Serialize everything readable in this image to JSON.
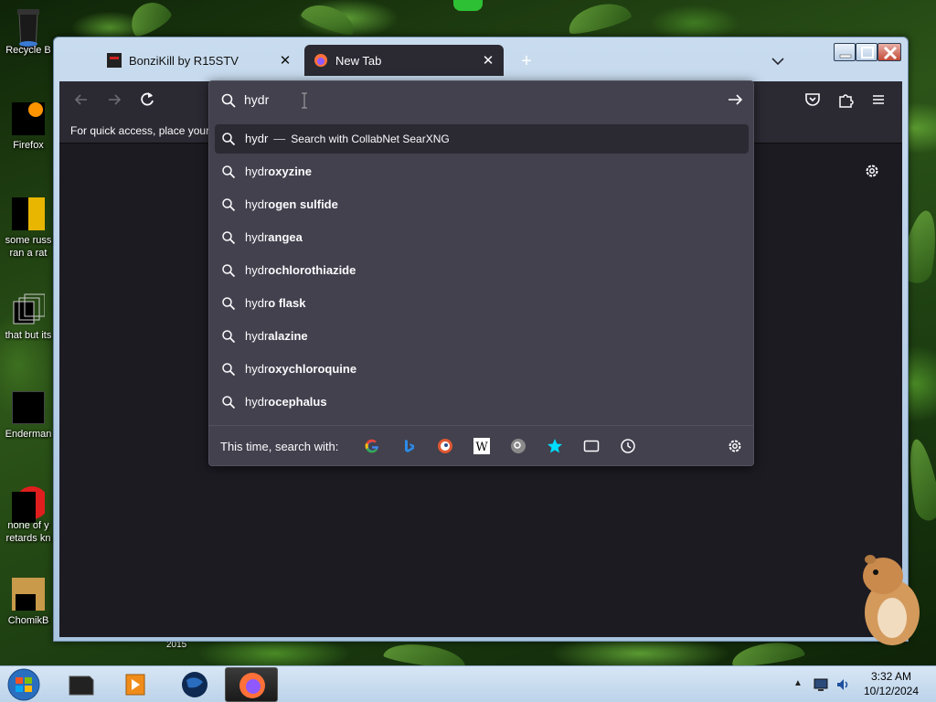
{
  "desktop": {
    "icons": [
      {
        "label": "Recycle B",
        "icon": "recycle-bin-icon"
      },
      {
        "label": "Firefox",
        "icon": "firefox-icon"
      },
      {
        "label": "some russ",
        "label2": "ran a rat",
        "icon": "photo-icon"
      },
      {
        "label": "that but its",
        "icon": "folder-stack-icon"
      },
      {
        "label": "Enderman",
        "icon": "window-app-icon"
      },
      {
        "label": "none of y",
        "label2": "retards kn",
        "icon": "opera-icon"
      },
      {
        "label": "ChomikB",
        "icon": "hamster-icon"
      }
    ],
    "year_label": "2015"
  },
  "browser": {
    "tabs": [
      {
        "title": "BonziKill by R15STV",
        "active": false
      },
      {
        "title": "New Tab",
        "active": true
      }
    ],
    "new_tab_symbol": "+",
    "close_symbol": "✕",
    "bookmarks_prompt": "For quick access, place your b",
    "urlbar": {
      "typed": "hydr",
      "search_action": {
        "query": "hydr",
        "separator": "—",
        "text": "Search with CollabNet SearXNG"
      },
      "suggestions": [
        {
          "prefix": "hydr",
          "rest": "oxyzine"
        },
        {
          "prefix": "hydr",
          "rest": "ogen sulfide"
        },
        {
          "prefix": "hydr",
          "rest": "angea"
        },
        {
          "prefix": "hydr",
          "rest": "ochlorothiazide"
        },
        {
          "prefix": "hydr",
          "rest": "o flask"
        },
        {
          "prefix": "hydr",
          "rest": "alazine"
        },
        {
          "prefix": "hydr",
          "rest": "oxychloroquine"
        },
        {
          "prefix": "hydr",
          "rest": "ocephalus"
        }
      ],
      "oneoff_label": "This time, search with:",
      "engines": [
        "google-icon",
        "bing-icon",
        "duckduckgo-icon",
        "wikipedia-icon",
        "searxng-icon",
        "bookmarks-star-icon",
        "tabs-icon",
        "history-icon"
      ]
    }
  },
  "taskbar": {
    "clock_time": "3:32 AM",
    "clock_date": "10/12/2024",
    "tray_expand": "▲"
  },
  "colors": {
    "accent": "#00ddff",
    "toolbar": "#2b2a33",
    "panel": "#42414d"
  }
}
